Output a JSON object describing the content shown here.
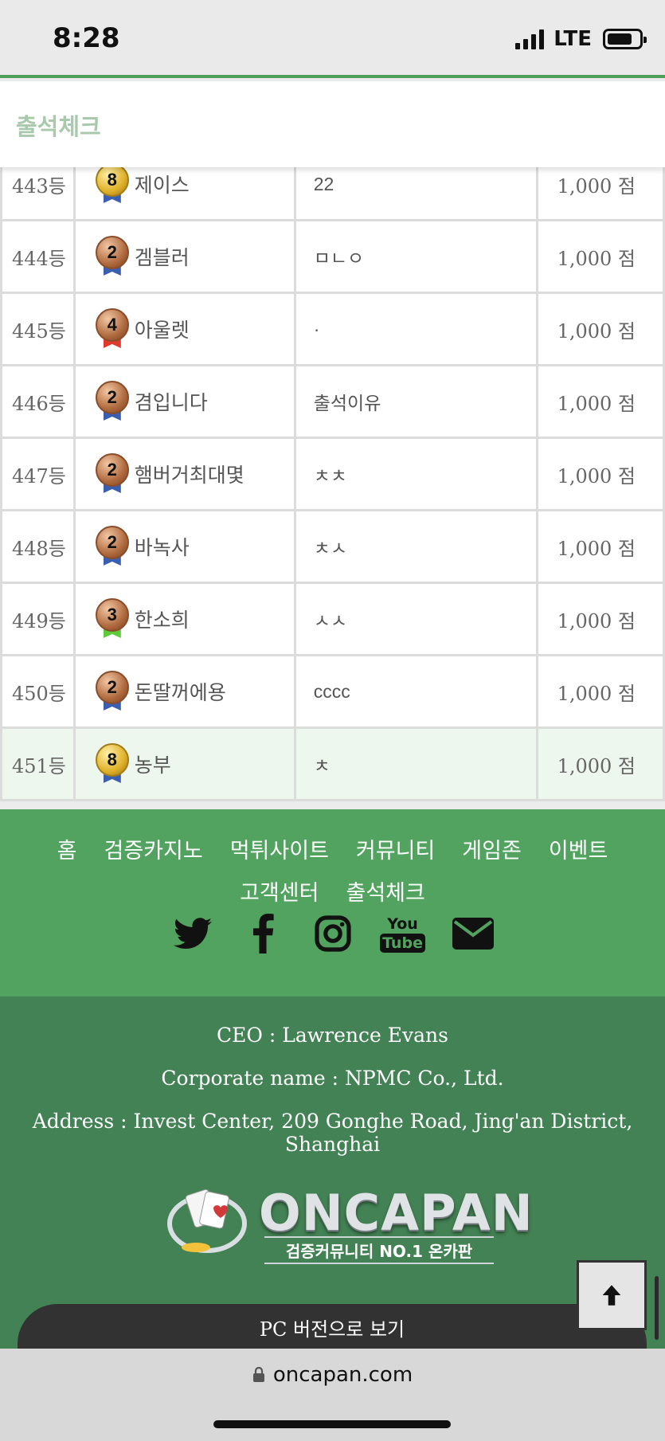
{
  "status_bar": {
    "time": "8:28",
    "network": "LTE"
  },
  "header": {
    "title": "출석체크"
  },
  "attendance": {
    "partial_row": {
      "rank": "443등",
      "name": "제이스",
      "message": "22",
      "points": "1,000 점",
      "level": "8"
    },
    "rows": [
      {
        "rank": "444등",
        "level": "2",
        "name": "겜블러",
        "message": "ㅁㄴㅇ",
        "points": "1,000 점"
      },
      {
        "rank": "445등",
        "level": "4",
        "name": "아울렛",
        "message": "·",
        "points": "1,000 점"
      },
      {
        "rank": "446등",
        "level": "2",
        "name": "겸입니다",
        "message": "출석이유",
        "points": "1,000 점"
      },
      {
        "rank": "447등",
        "level": "2",
        "name": "햄버거최대몇",
        "message": "ㅊㅊ",
        "points": "1,000 점"
      },
      {
        "rank": "448등",
        "level": "2",
        "name": "바녹사",
        "message": "ㅊㅅ",
        "points": "1,000 점"
      },
      {
        "rank": "449등",
        "level": "3",
        "name": "한소희",
        "message": "ㅅㅅ",
        "points": "1,000 점"
      },
      {
        "rank": "450등",
        "level": "2",
        "name": "돈딸꺼에용",
        "message": "cccc",
        "points": "1,000 점"
      },
      {
        "rank": "451등",
        "level": "8",
        "name": "농부",
        "message": "ㅊ",
        "points": "1,000 점"
      }
    ]
  },
  "footer": {
    "nav": [
      "홈",
      "검증카지노",
      "먹튀사이트",
      "커뮤니티",
      "게임존",
      "이벤트",
      "고객센터",
      "출석체크"
    ],
    "social": [
      "twitter-icon",
      "facebook-icon",
      "instagram-icon",
      "youtube-icon",
      "email-icon"
    ],
    "youtube_you": "You",
    "youtube_tube": "Tube",
    "ceo": "CEO : Lawrence Evans",
    "corporate": "Corporate name : NPMC Co., Ltd.",
    "address": "Address : Invest Center, 209 Gonghe Road, Jing'an District, Shanghai",
    "logo_word": "ONCAPAN",
    "logo_tagline": "검증커뮤니티 NO.1 온카판",
    "pc_version": "PC 버전으로 보기"
  },
  "browser": {
    "url": "oncapan.com"
  },
  "colors": {
    "accent_green": "#51a35f",
    "dark_green": "#438254",
    "header_title": "#a9c9ac",
    "highlight_row": "#eef7ee"
  }
}
